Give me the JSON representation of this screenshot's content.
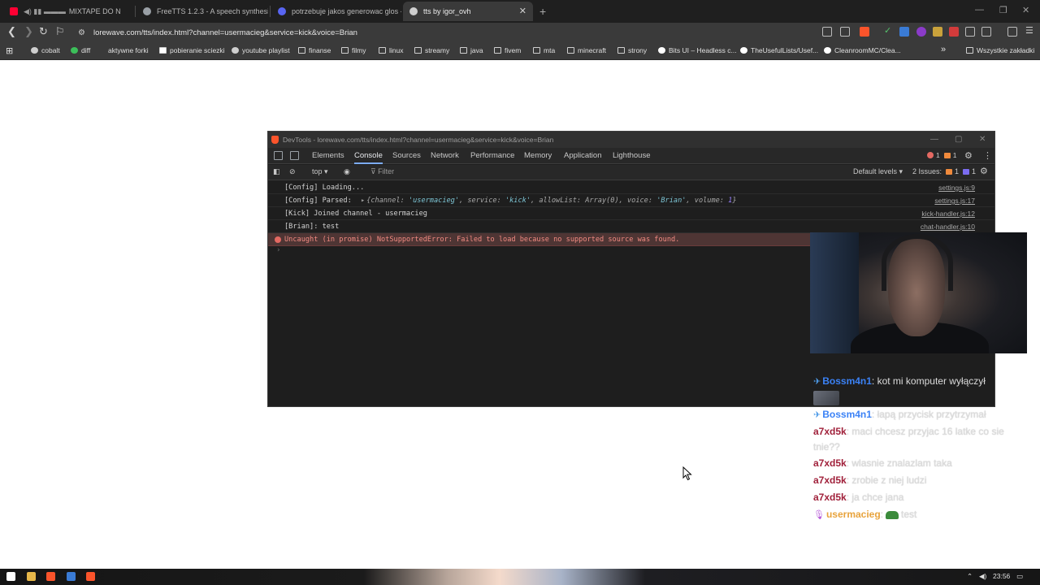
{
  "tabs": [
    {
      "title": "MIXTAPE DO N",
      "favicon_color": "#ff0033"
    },
    {
      "title": "FreeTTS 1.2.3 - A speech synthesizer",
      "favicon_color": "#9aa0a6"
    },
    {
      "title": "potrzebuje jakos generowac glos - D",
      "favicon_color": "#5865f2"
    },
    {
      "title": "tts by igor_ovh",
      "favicon_color": "#cfcfcf"
    }
  ],
  "address_bar": {
    "url": "lorewave.com/tts/index.html?channel=usermacieg&service=kick&voice=Brian"
  },
  "bookmarks": [
    {
      "label": "cobalt",
      "icon": "cobalt-icon"
    },
    {
      "label": "diff",
      "icon": "diff-icon"
    },
    {
      "label": "aktywne forki",
      "icon": "fork-icon"
    },
    {
      "label": "pobieranie sciezki",
      "icon": "download-icon"
    },
    {
      "label": "youtube playlist",
      "icon": "globe-icon"
    },
    {
      "label": "finanse",
      "icon": "folder-icon"
    },
    {
      "label": "filmy",
      "icon": "folder-icon"
    },
    {
      "label": "linux",
      "icon": "folder-icon"
    },
    {
      "label": "streamy",
      "icon": "folder-icon"
    },
    {
      "label": "java",
      "icon": "folder-icon"
    },
    {
      "label": "fivem",
      "icon": "folder-icon"
    },
    {
      "label": "mta",
      "icon": "folder-icon"
    },
    {
      "label": "minecraft",
      "icon": "folder-icon"
    },
    {
      "label": "strony",
      "icon": "folder-icon"
    },
    {
      "label": "Bits UI – Headless c...",
      "icon": "bits-icon"
    },
    {
      "label": "TheUsefulLists/Usef...",
      "icon": "github-icon"
    },
    {
      "label": "CleanroomMC/Clea...",
      "icon": "github-icon"
    }
  ],
  "all_bookmarks_label": "Wszystkie zakładki",
  "devtools": {
    "title": "DevTools - lorewave.com/tts/index.html?channel=usermacieg&service=kick&voice=Brian",
    "tabs": [
      "Elements",
      "Console",
      "Sources",
      "Network",
      "Performance",
      "Memory",
      "Application",
      "Lighthouse"
    ],
    "active_tab": "Console",
    "error_count": "1",
    "warning_count": "1",
    "context": "top",
    "filter_placeholder": "Filter",
    "levels": "Default levels",
    "issues_label": "2 Issues:",
    "issues_warn": "1",
    "issues_info": "1",
    "console": {
      "line1": {
        "text": "[Config] Loading...",
        "source": "settings.js:9"
      },
      "line2": {
        "prefix": "[Config] Parsed:",
        "obj_open": "{channel: ",
        "channel": "'usermacieg'",
        "sep1": ", service: ",
        "service": "'kick'",
        "sep2": ", allowList: Array(0), voice: ",
        "voice": "'Brian'",
        "sep3": ", volume: ",
        "volume": "1",
        "obj_close": "}",
        "source": "settings.js:17"
      },
      "line3": {
        "text": "[Kick] Joined channel - usermacieg",
        "source": "kick-handler.js:12"
      },
      "line4": {
        "text": "[Brian]: test",
        "source": "chat-handler.js:10"
      },
      "error": {
        "text": "Uncaught (in promise) NotSupportedError: Failed to load because no supported source was found."
      }
    }
  },
  "chat": [
    {
      "user": "Bossm4n1",
      "text": ": kot mi komputer wyłączył",
      "badge": "pin"
    },
    {
      "user": "Bossm4n1",
      "text": ": łapą przycisk przytrzymał",
      "badge": "pin"
    },
    {
      "user": "a7xd5k",
      "text": ": maci chcesz przyjac 16 latke co sie tnie??"
    },
    {
      "user": "a7xd5k",
      "text": ": wlasnie znalazlam taka"
    },
    {
      "user": "a7xd5k",
      "text": ": zrobie z niej ludzi"
    },
    {
      "user": "a7xd5k",
      "text": ": ja chce jana"
    },
    {
      "user": "usermacieg",
      "text": "test",
      "badge": "mic"
    }
  ],
  "taskbar": {
    "time": "23:56"
  },
  "colors": {
    "accent": "#7cacf8",
    "error": "#e46962",
    "warning": "#f08a3c"
  }
}
